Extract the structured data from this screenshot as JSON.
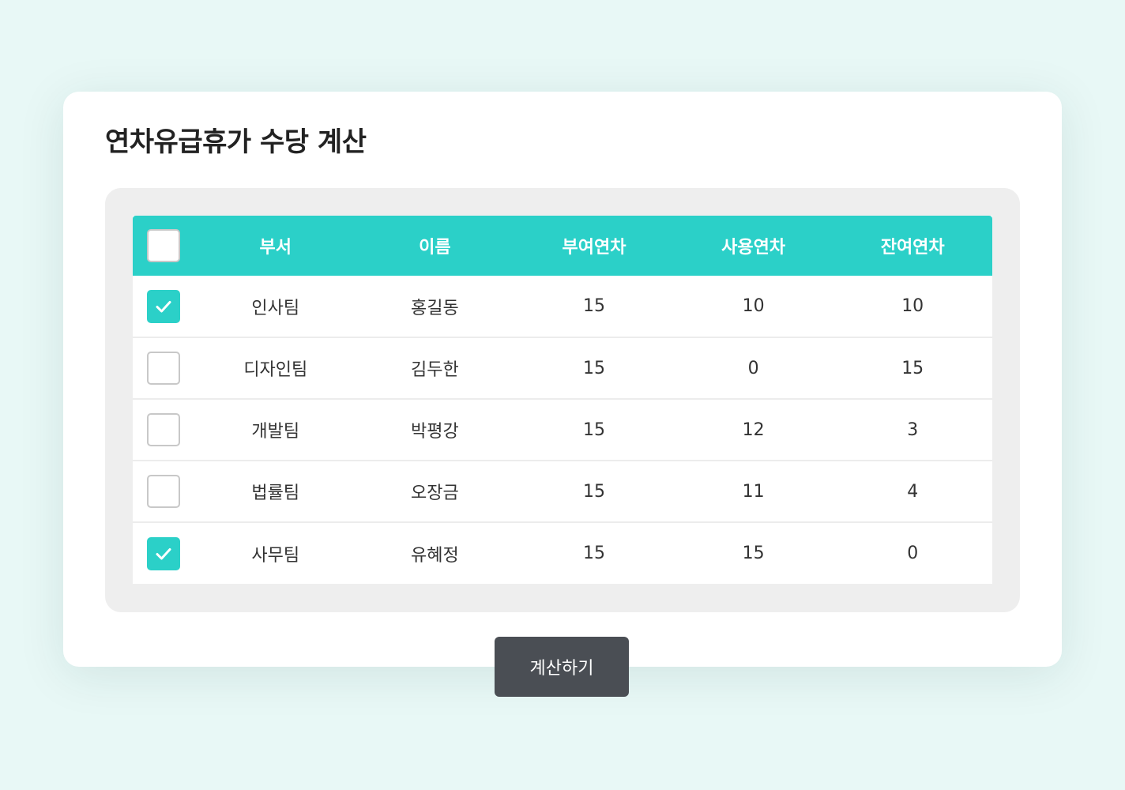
{
  "title": "연차유급휴가 수당 계산",
  "table": {
    "headers": [
      "부서",
      "이름",
      "부여연차",
      "사용연차",
      "잔여연차"
    ],
    "select_all_checked": false,
    "rows": [
      {
        "checked": true,
        "cells": [
          "인사팀",
          "홍길동",
          "15",
          "10",
          "10"
        ]
      },
      {
        "checked": false,
        "cells": [
          "디자인팀",
          "김두한",
          "15",
          "0",
          "15"
        ]
      },
      {
        "checked": false,
        "cells": [
          "개발팀",
          "박평강",
          "15",
          "12",
          "3"
        ]
      },
      {
        "checked": false,
        "cells": [
          "법률팀",
          "오장금",
          "15",
          "11",
          "4"
        ]
      },
      {
        "checked": true,
        "cells": [
          "사무팀",
          "유혜정",
          "15",
          "15",
          "0"
        ]
      }
    ]
  },
  "button": {
    "calculate_label": "계산하기"
  },
  "colors": {
    "page_background": "#e8f8f6",
    "accent": "#2bd0c8",
    "button_background": "#4a4e54",
    "table_frame": "#eeeeee"
  },
  "icons": {
    "checkbox_checked": "checkmark-icon"
  }
}
